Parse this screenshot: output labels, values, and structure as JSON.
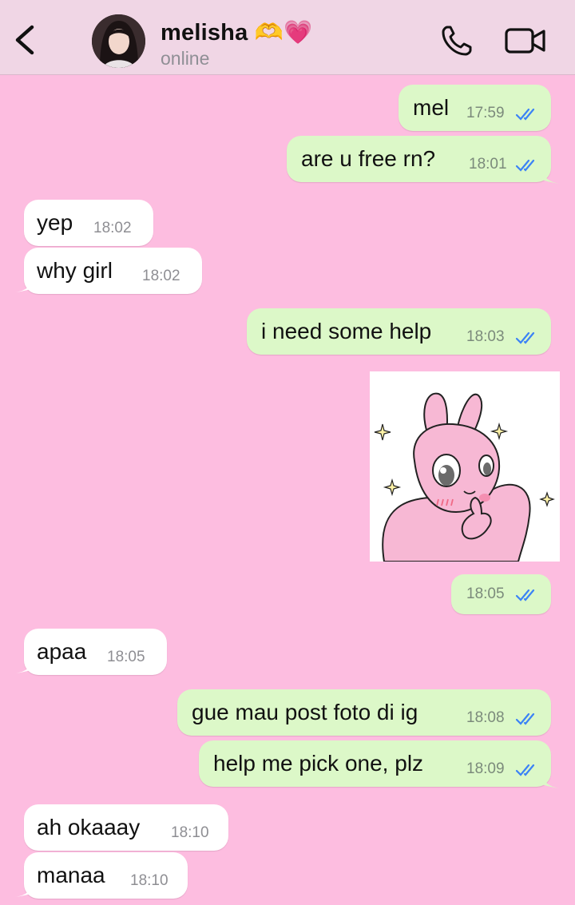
{
  "header": {
    "back_icon": "chevron-left-icon",
    "contact_name": "melisha 🫶💗",
    "status": "online",
    "call_icon": "phone-icon",
    "video_icon": "video-camera-icon"
  },
  "colors": {
    "background": "#fdbde0",
    "header_bg": "#f0d6e5",
    "outgoing_bubble": "#dcf8c8",
    "incoming_bubble": "#ffffff",
    "read_ticks": "#3b82f6"
  },
  "messages": [
    {
      "dir": "out",
      "text": "mel",
      "time": "17:59",
      "read": true
    },
    {
      "dir": "out",
      "text": "are u free rn?",
      "time": "18:01",
      "read": true
    },
    {
      "dir": "in",
      "text": "yep",
      "time": "18:02"
    },
    {
      "dir": "in",
      "text": "why girl",
      "time": "18:02"
    },
    {
      "dir": "out",
      "text": "i need some help",
      "time": "18:03",
      "read": true
    },
    {
      "dir": "out",
      "type": "sticker",
      "sticker": "pink-bunny-sticker",
      "time": "18:05",
      "read": true
    },
    {
      "dir": "in",
      "text": "apaa",
      "time": "18:05"
    },
    {
      "dir": "out",
      "text": "gue mau post foto di ig",
      "time": "18:08",
      "read": true
    },
    {
      "dir": "out",
      "text": "help me pick one, plz",
      "time": "18:09",
      "read": true
    },
    {
      "dir": "in",
      "text": "ah okaaay",
      "time": "18:10"
    },
    {
      "dir": "in",
      "text": "manaa",
      "time": "18:10"
    }
  ]
}
